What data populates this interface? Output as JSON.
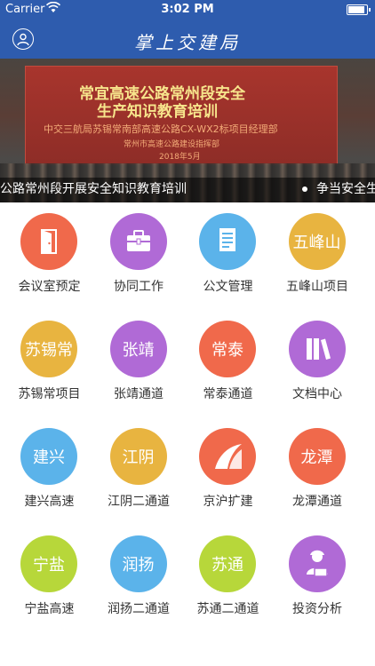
{
  "status": {
    "carrier": "Carrier",
    "time": "3:02 PM"
  },
  "nav": {
    "title": "掌上交建局",
    "user_icon": "user-icon"
  },
  "banner": {
    "slide_title_1": "常宜高速公路常州段安全",
    "slide_title_2": "生产知识教育培训",
    "slide_line_3": "中交三航局苏锡常南部高速公路CX-WX2标项目经理部",
    "slide_line_4": "常州市高速公路建设指挥部",
    "slide_line_5": "2018年5月",
    "caption": "公路常州段开展安全知识教育培训",
    "caption_next": "争当安全生"
  },
  "grid": [
    {
      "label": "会议室预定",
      "icon": "door-icon",
      "text": "",
      "color": "#f0694b"
    },
    {
      "label": "协同工作",
      "icon": "briefcase-icon",
      "text": "",
      "color": "#b06ad6"
    },
    {
      "label": "公文管理",
      "icon": "document-icon",
      "text": "",
      "color": "#5bb3ea"
    },
    {
      "label": "五峰山项目",
      "icon": "",
      "text": "五峰山",
      "color": "#e8b440"
    },
    {
      "label": "苏锡常项目",
      "icon": "",
      "text": "苏锡常",
      "color": "#e8b440"
    },
    {
      "label": "张靖通道",
      "icon": "",
      "text": "张靖",
      "color": "#b06ad6"
    },
    {
      "label": "常泰通道",
      "icon": "",
      "text": "常泰",
      "color": "#f0694b"
    },
    {
      "label": "文档中心",
      "icon": "books-icon",
      "text": "",
      "color": "#b06ad6"
    },
    {
      "label": "建兴高速",
      "icon": "",
      "text": "建兴",
      "color": "#5bb3ea"
    },
    {
      "label": "江阴二通道",
      "icon": "",
      "text": "江阴",
      "color": "#e8b440"
    },
    {
      "label": "京沪扩建",
      "icon": "road-icon",
      "text": "",
      "color": "#f0694b"
    },
    {
      "label": "龙潭通道",
      "icon": "",
      "text": "龙潭",
      "color": "#f0694b"
    },
    {
      "label": "宁盐高速",
      "icon": "",
      "text": "宁盐",
      "color": "#b7d73a"
    },
    {
      "label": "润扬二通道",
      "icon": "",
      "text": "润扬",
      "color": "#5bb3ea"
    },
    {
      "label": "苏通二通道",
      "icon": "",
      "text": "苏通",
      "color": "#b7d73a"
    },
    {
      "label": "投资分析",
      "icon": "analyst-icon",
      "text": "",
      "color": "#b06ad6"
    }
  ]
}
